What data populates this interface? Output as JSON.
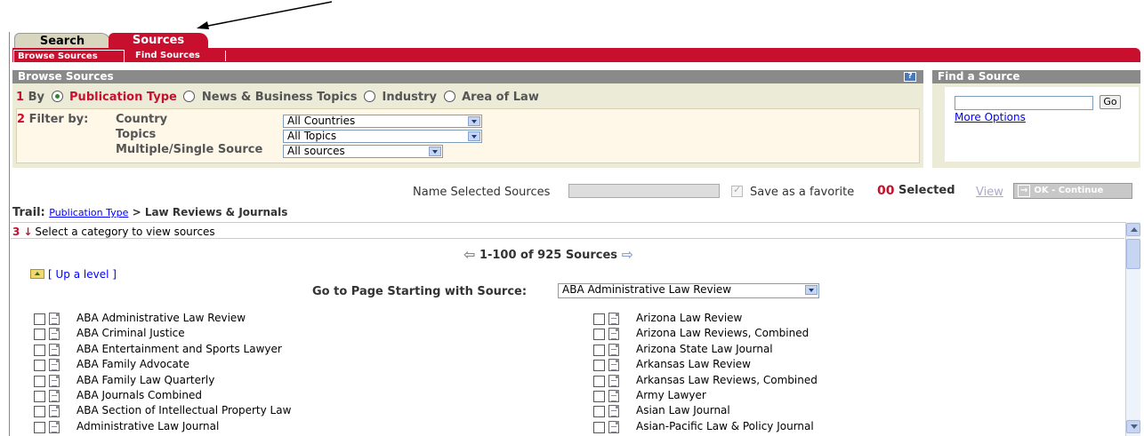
{
  "tabs": [
    {
      "label": "Search"
    },
    {
      "label": "Sources"
    }
  ],
  "subtabs": [
    {
      "label": "Browse Sources"
    },
    {
      "label": "Find Sources"
    }
  ],
  "browse": {
    "title": "Browse Sources",
    "help_label": "?",
    "by_number": "1",
    "by_label": "By",
    "options": [
      "Publication Type",
      "News & Business Topics",
      "Industry",
      "Area of Law"
    ],
    "selected_option": "Publication Type",
    "filter_number": "2",
    "filter_label": "Filter by:",
    "filters": [
      {
        "label": "Country",
        "value": "All Countries"
      },
      {
        "label": "Topics",
        "value": "All Topics"
      },
      {
        "label": "Multiple/Single Source",
        "value": "All sources"
      }
    ]
  },
  "find": {
    "title": "Find a Source",
    "input_value": "",
    "go_label": "Go",
    "more_options": "More Options"
  },
  "selection": {
    "name_label": "Name Selected Sources",
    "favorite_label": "Save as a favorite",
    "count": "00",
    "selected_label": "Selected",
    "view_label": "View",
    "ok_label": "OK - Continue",
    "ok_icon": "→"
  },
  "trail": {
    "label": "Trail:",
    "link": "Publication Type",
    "rest": " > Law Reviews & Journals"
  },
  "step3": {
    "number": "3",
    "arrow": "↓",
    "text": "Select a category to view sources"
  },
  "pager": {
    "prev_icon": "⇦",
    "text": "1-100 of 925 Sources",
    "next_icon": "⇨"
  },
  "up_level": "[ Up a level ]",
  "goto": {
    "label": "Go to Page Starting with Source:",
    "value": "ABA Administrative Law Review"
  },
  "sources_left": [
    "ABA Administrative Law Review",
    "ABA Criminal Justice",
    "ABA Entertainment and Sports Lawyer",
    "ABA Family Advocate",
    "ABA Family Law Quarterly",
    "ABA Journals Combined",
    "ABA Section of Intellectual Property Law",
    "Administrative Law Journal"
  ],
  "sources_right": [
    "Arizona Law Review",
    "Arizona Law Reviews, Combined",
    "Arizona State Law Journal",
    "Arkansas Law Review",
    "Arkansas Law Reviews, Combined",
    "Army Lawyer",
    "Asian Law Journal",
    "Asian-Pacific Law & Policy Journal"
  ],
  "colors": {
    "brand_red": "#c8102e",
    "panel_gray": "#8a8a8a",
    "panel_bg": "#ecebd8",
    "link_blue": "#0000ff"
  }
}
